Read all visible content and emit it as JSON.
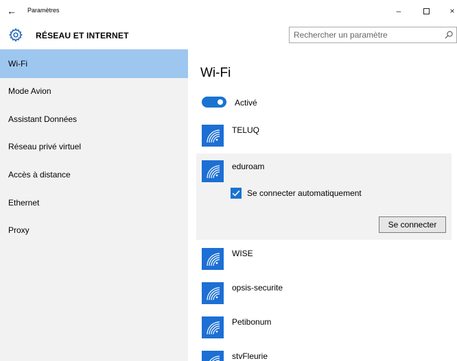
{
  "window": {
    "title": "Paramètres",
    "back_glyph": "←",
    "minimize_glyph": "–",
    "close_glyph": "×"
  },
  "header": {
    "title": "RÉSEAU ET INTERNET",
    "icon": "gear-icon",
    "search": {
      "placeholder": "Rechercher un paramètre",
      "value": ""
    }
  },
  "sidebar": {
    "active": "Wi-Fi",
    "items": [
      {
        "label": "Wi-Fi"
      },
      {
        "label": "Mode Avion"
      },
      {
        "label": "Assistant Données"
      },
      {
        "label": "Réseau privé virtuel"
      },
      {
        "label": "Accès à distance"
      },
      {
        "label": "Ethernet"
      },
      {
        "label": "Proxy"
      }
    ]
  },
  "main": {
    "title": "Wi-Fi",
    "toggle": {
      "label": "Activé",
      "on": true
    },
    "networks": [
      {
        "name": "TELUQ"
      },
      {
        "name": "eduroam",
        "selected": true,
        "auto_connect_label": "Se connecter automatiquement",
        "auto_connect": true,
        "connect_label": "Se connecter"
      },
      {
        "name": "WISE"
      },
      {
        "name": "opsis-securite"
      },
      {
        "name": "Petibonum"
      },
      {
        "name": "stvFleurie"
      }
    ]
  },
  "colors": {
    "accent": "#1a73d1",
    "nav_active": "#9ec7ef",
    "sidebar_bg": "#f2f2f2",
    "selected_bg": "#f2f2f2",
    "wifi_tile": "#1c6fd4"
  }
}
